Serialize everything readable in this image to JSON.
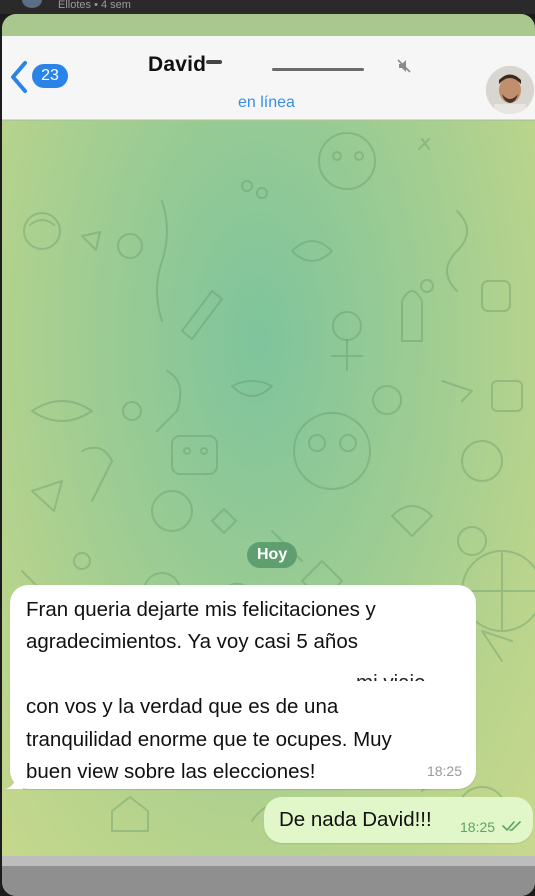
{
  "status_bar": {
    "text": "Ellotes • 4 sem"
  },
  "header": {
    "back_badge": "23",
    "contact_name": "David",
    "presence": "en línea",
    "mute_icon": "muted-bell-icon",
    "avatar_icon": "contact-avatar"
  },
  "chat": {
    "date_separator": "Hoy",
    "incoming": {
      "lines": [
        "Fran queria dejarte mis felicitaciones y",
        "agradecimientos. Ya voy casi 5 años",
        "con vos y la verdad que es de una",
        "tranquilidad enorme que te ocupes. Muy",
        "buen view sobre las elecciones!"
      ],
      "obscured_fragment": "mi viaje",
      "time": "18:25"
    },
    "outgoing": {
      "text": "De nada David!!!",
      "time": "18:25",
      "status_icon": "double-check-icon"
    }
  },
  "colors": {
    "accent": "#2a83e8",
    "outgoing_bubble": "#e1f7c9",
    "date_pill": "#5f9e6f",
    "wallpaper": "#9ccc93"
  }
}
